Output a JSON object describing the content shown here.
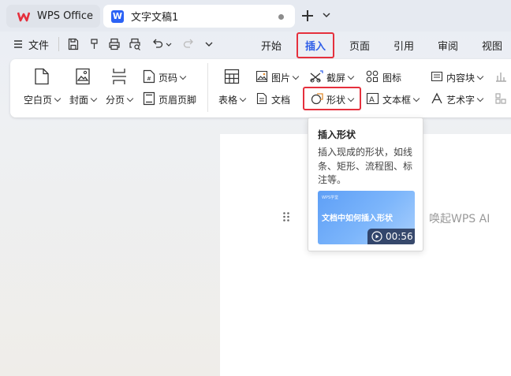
{
  "titlebar": {
    "home_tab": "WPS Office",
    "doc_tab": "文字文稿1",
    "new_tab_icon": "plus-icon"
  },
  "menubar": {
    "file": "文件",
    "tabs": [
      "开始",
      "插入",
      "页面",
      "引用",
      "审阅",
      "视图"
    ],
    "active_tab": "插入"
  },
  "ribbon": {
    "blank_page": "空白页",
    "cover": "封面",
    "page_break": "分页",
    "page_number": "页码",
    "header_footer": "页眉页脚",
    "table": "表格",
    "picture": "图片",
    "document": "文档",
    "screenshot": "截屏",
    "shape": "形状",
    "icon": "图标",
    "text_box": "文本框",
    "content_control": "内容块",
    "word_art": "艺术字"
  },
  "tooltip": {
    "title": "插入形状",
    "description": "插入现成的形状，如线条、矩形、流程图、标注等。",
    "video_brand": "WPS学堂",
    "video_title": "文档中如何插入形状",
    "video_duration": "00:56"
  },
  "document": {
    "ai_hint": "唤起WPS AI"
  },
  "colors": {
    "accent_blue": "#2f5ee8",
    "highlight_red": "#e5303d",
    "wps_logo": "#e5303d"
  }
}
